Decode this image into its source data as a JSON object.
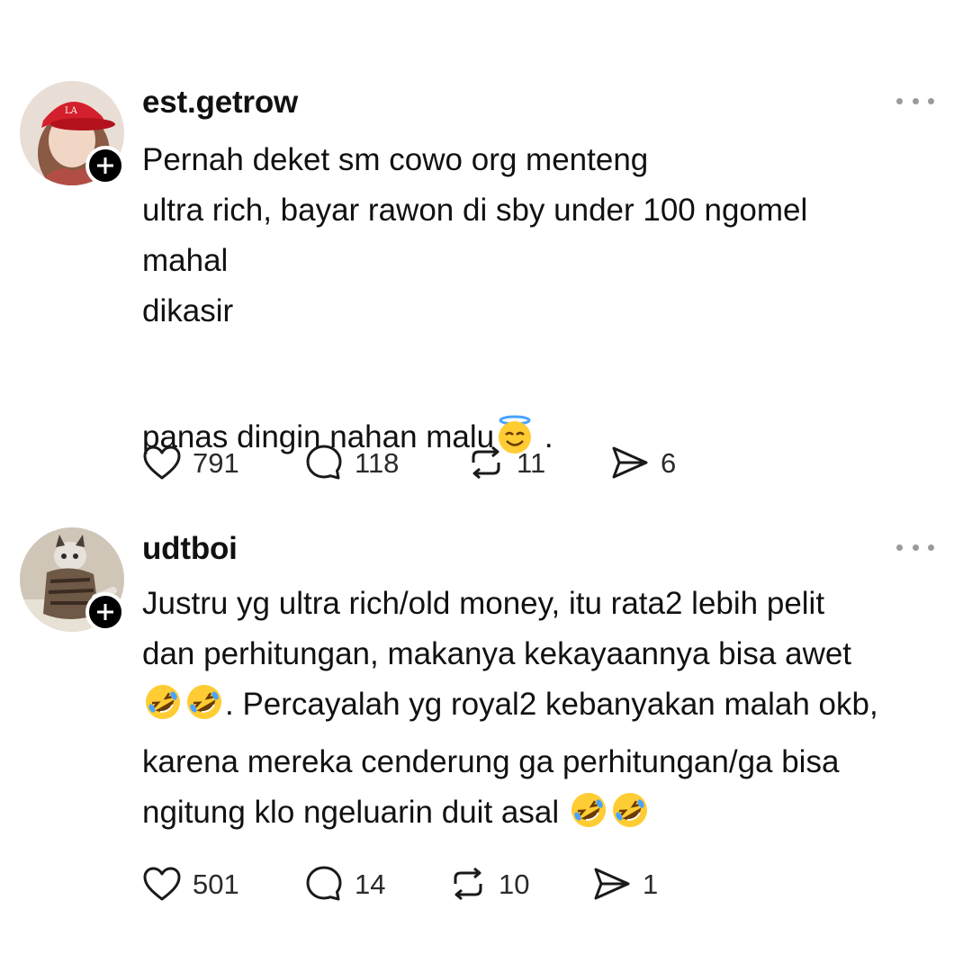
{
  "colors": {
    "text": "#111111",
    "muted": "#9a9a9a",
    "badge": "#000000"
  },
  "posts": [
    {
      "username": "est.getrow",
      "avatar": "woman-in-red-cap-avatar",
      "body": [
        "Pernah deket sm cowo org menteng\nultra rich, bayar rawon di sby under 100 ngomel\nmahal\ndikasir"
      ],
      "body_last": {
        "text_before": "panas dingin nahan malu",
        "emoji": "smiling-face-with-halo",
        "text_after": " ."
      },
      "actions": {
        "likes": "791",
        "replies": "118",
        "reposts": "11",
        "shares": "6"
      }
    },
    {
      "username": "udtboi",
      "avatar": "cat-in-sweater-avatar",
      "line1": "Justru yg ultra rich/old money, itu rata2 lebih pelit",
      "line2": "dan perhitungan, makanya kekayaannya bisa awet",
      "line3_after_emoji": ". Percayalah yg royal2 kebanyakan malah okb,",
      "line4": "karena mereka cenderung ga perhitungan/ga bisa",
      "line5_before_emoji": "ngitung klo ngeluarin duit asal ",
      "emoji": "rolling-on-floor-laughing",
      "actions": {
        "likes": "501",
        "replies": "14",
        "reposts": "10",
        "shares": "1"
      }
    }
  ]
}
